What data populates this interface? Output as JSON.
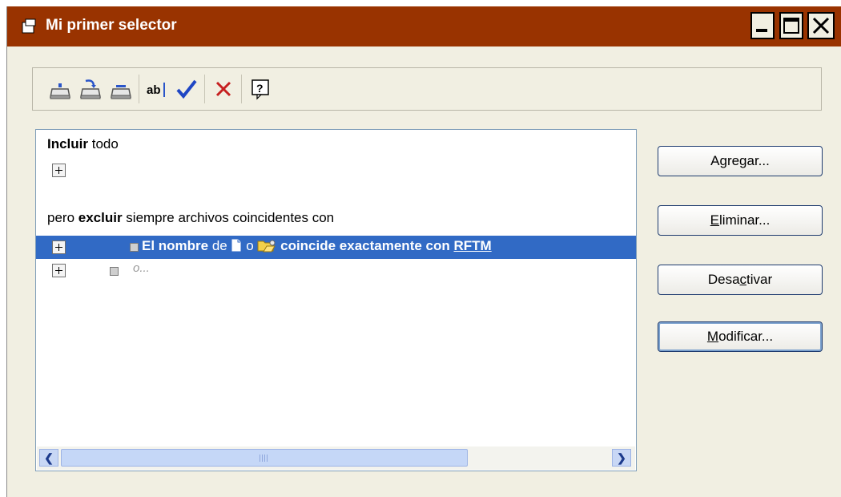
{
  "window": {
    "title": "Mi primer selector",
    "controls": {
      "minimize": "_",
      "maximize": "□",
      "close": "X"
    }
  },
  "toolbar": {
    "buttons": [
      {
        "name": "upload-icon",
        "label": ""
      },
      {
        "name": "insert-icon",
        "label": ""
      },
      {
        "name": "remove-icon",
        "label": ""
      },
      {
        "name": "rename-icon",
        "label": "ab|"
      },
      {
        "name": "check-icon",
        "label": "✔"
      },
      {
        "name": "delete-icon",
        "label": "✕"
      },
      {
        "name": "help-icon",
        "label": "?"
      }
    ]
  },
  "rules": {
    "include_strong": "Incluir",
    "include_rest": " todo",
    "exclude_pre": "pero ",
    "exclude_strong": "excluir",
    "exclude_rest": " siempre archivos coincidentes con",
    "selected": {
      "part1": "El nombre",
      "part2": " de ",
      "part3": " o ",
      "part4": " coincide exactamente con ",
      "value": "RFTM"
    },
    "placeholder": "o..."
  },
  "buttons": {
    "add": {
      "pre": "A",
      "ul": "g",
      "post": "regar..."
    },
    "remove": {
      "pre": "",
      "ul": "E",
      "post": "liminar..."
    },
    "deactivate": {
      "pre": "Desa",
      "ul": "c",
      "post": "tivar"
    },
    "modify": {
      "pre": "",
      "ul": "M",
      "post": "odificar..."
    }
  },
  "colors": {
    "titlebar": "#993300",
    "selection": "#316ac5",
    "dialog_bg": "#f1efe2"
  }
}
